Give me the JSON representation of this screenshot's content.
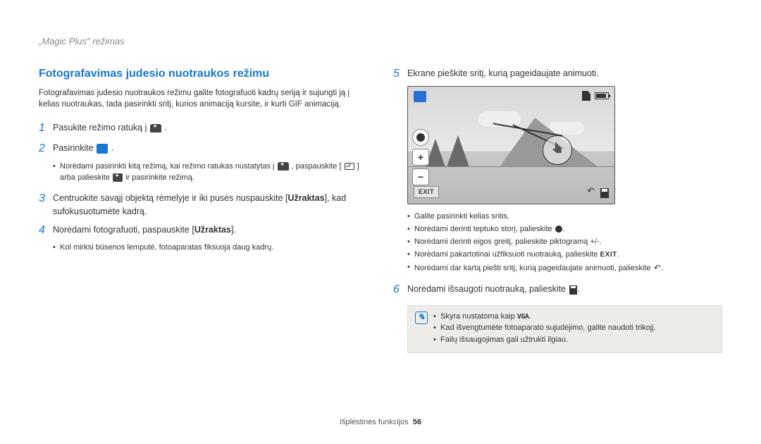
{
  "header": {
    "breadcrumb": "„Magic Plus\" režimas"
  },
  "left": {
    "title": "Fotografavimas judesio nuotraukos režimu",
    "intro": "Fotografavimas judesio nuotraukos režimu galite fotografuoti kadrų seriją ir sujungti ją į kelias nuotraukas, tada pasirinkti sritį, kurios animaciją kursite, ir kurti GIF animaciją.",
    "step1": {
      "num": "1",
      "text_before": "Pasukite režimo ratuką į ",
      "text_after": " ."
    },
    "step2": {
      "num": "2",
      "text_before": "Pasirinkite ",
      "text_after": " ."
    },
    "step2_note": {
      "a": "Norėdami pasirinkti kitą režimą, kai režimo ratukas nustatytas į ",
      "b": " , paspauskite [",
      "c": "] arba palieskite ",
      "d": " ir pasirinkite režimą."
    },
    "step3": {
      "num": "3",
      "text": "Centruokite savąjį objektą rėmelyje ir iki pusės nuspauskite [",
      "bold": "Užraktas",
      "text2": "], kad sufokusuotumėte kadrą."
    },
    "step4": {
      "num": "4",
      "text": "Norėdami fotografuoti, paspauskite [",
      "bold": "Užraktas",
      "text2": "]."
    },
    "step4_note": "Kol mirksi būsenos lemputė, fotoaparatas fiksuoja daug kadrų."
  },
  "right": {
    "step5": {
      "num": "5",
      "text": "Ekrane pieškite sritį, kurią pageidaujate animuoti."
    },
    "screen": {
      "exit": "EXIT"
    },
    "bullets": {
      "b1": "Galite pasirinkti kelias sritis.",
      "b2a": "Norėdami derinti teptuko storį, palieskite ",
      "b2b": ".",
      "b3": "Norėdami derinti eigos greitį, palieskite piktogramą +/-.",
      "b4a": "Norėdami pakartotinai užfiksuoti nuotrauką, palieskite ",
      "b4exit": "EXIT",
      "b4b": ".",
      "b5a": "Norėdami dar kartą piešti sritį, kurią pageidaujate animuoti, palieskite ",
      "b5b": "."
    },
    "step6": {
      "num": "6",
      "text": "Norėdami išsaugoti nuotrauką, palieskite ",
      "text2": "."
    },
    "note": {
      "n1a": "Skyra nustatoma kaip ",
      "n1vga": "VGA",
      "n1b": ".",
      "n2": "Kad išvengtumėte fotoaparato sujudėjimo, galite naudoti trikojį.",
      "n3": "Failų išsaugojimas gali užtrukti ilgiau."
    }
  },
  "footer": {
    "label": "Išplėstinės funkcijos",
    "page": "56"
  }
}
